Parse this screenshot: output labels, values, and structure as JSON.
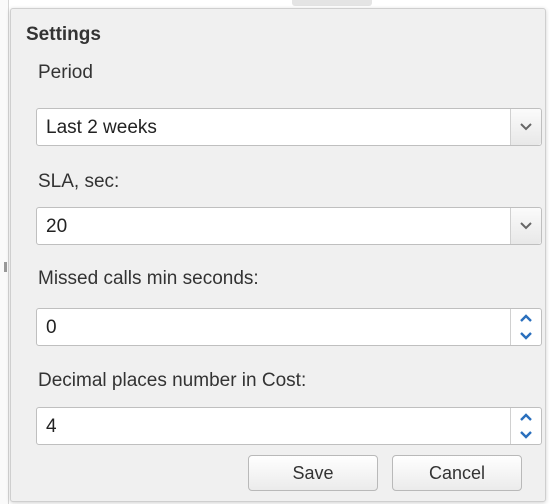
{
  "dialog": {
    "title": "Settings",
    "buttons": {
      "save": "Save",
      "cancel": "Cancel"
    }
  },
  "fields": {
    "period": {
      "label": "Period",
      "value": "Last 2 weeks",
      "control": "dropdown",
      "icon": "chevron-down-icon"
    },
    "sla": {
      "label": "SLA, sec:",
      "value": "20",
      "control": "dropdown",
      "icon": "chevron-down-icon"
    },
    "missed_calls": {
      "label": "Missed calls min seconds:",
      "value": "0",
      "control": "spinner",
      "icons": [
        "spinner-up-icon",
        "spinner-down-icon"
      ]
    },
    "decimal_places": {
      "label": "Decimal places number in Cost:",
      "value": "4",
      "control": "spinner",
      "icons": [
        "spinner-up-icon",
        "spinner-down-icon"
      ]
    }
  },
  "colors": {
    "dialog_bg": "#f0f0f0",
    "field_bg": "#ffffff",
    "spinner_arrow": "#2a6fbd",
    "dropdown_arrow": "#666666"
  }
}
